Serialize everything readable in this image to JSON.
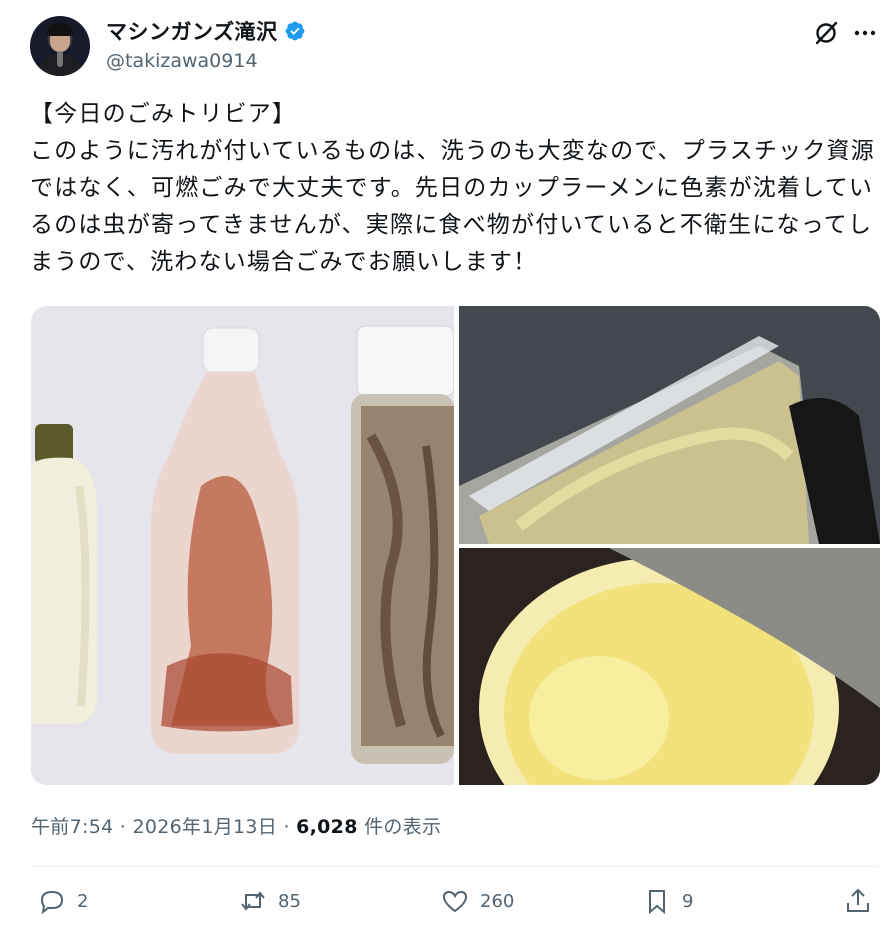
{
  "author": {
    "display_name": "マシンガンズ滝沢",
    "handle": "@takizawa0914",
    "verified": true,
    "avatar_icon": "user-avatar"
  },
  "header_icons": [
    "grok-icon",
    "more-icon"
  ],
  "tweet": {
    "text": "【今日のごみトリビア】\nこのように汚れが付いているものは、洗うのも大変なので、プラスチック資源ではなく、可燃ごみで大丈夫です。先日のカップラーメンに色素が沈着しているのは虫が寄ってきませんが、実際に食べ物が付いていると不衛生になってしまうので、洗わない場合ごみでお願いします！"
  },
  "meta": {
    "time": "午前7:54 · 2026年1月13日 · ",
    "views": "6,028",
    "views_suffix": " 件の表示"
  },
  "actions": {
    "replies": "2",
    "reposts": "85",
    "likes": "260",
    "bookmarks": "9"
  },
  "colors": {
    "accent": "#1d9bf0",
    "text": "#0f1419",
    "muted": "#536471"
  }
}
